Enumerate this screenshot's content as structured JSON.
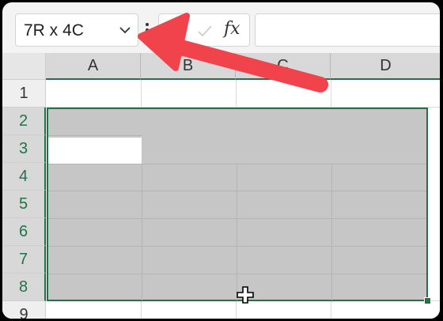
{
  "name_box": {
    "value": "7R x 4C",
    "icon": "chevron-down-icon"
  },
  "formula_bar": {
    "cancel_icon": "cancel-icon",
    "enter_icon": "check-icon",
    "fx_label": "fx",
    "value": ""
  },
  "columns": [
    "A",
    "B",
    "C",
    "D"
  ],
  "rows": [
    "1",
    "2",
    "3",
    "4",
    "5",
    "6",
    "7",
    "8",
    "9"
  ],
  "selection": {
    "range_rows": 7,
    "range_cols": 4
  },
  "annotation": {
    "color": "#f0434c"
  },
  "colors": {
    "accent": "#217346",
    "selection_fill": "#c6c6c6"
  }
}
